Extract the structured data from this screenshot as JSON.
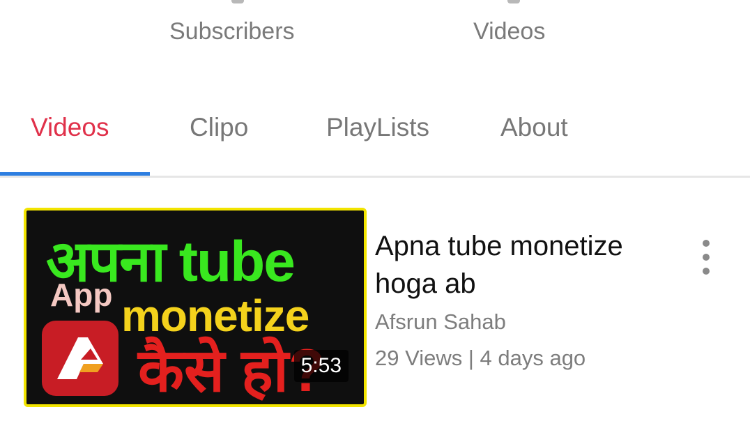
{
  "stats": {
    "subscribers_label": "Subscribers",
    "videos_label": "Videos"
  },
  "tabs": [
    {
      "label": "Videos",
      "active": true
    },
    {
      "label": "Clipo",
      "active": false
    },
    {
      "label": "PlayLists",
      "active": false
    },
    {
      "label": "About",
      "active": false
    }
  ],
  "video": {
    "title": "Apna tube monetize hoga ab",
    "channel": "Afsrun Sahab",
    "meta": "29 Views | 4 days ago",
    "duration": "5:53",
    "thumbnail": {
      "line1": "अपना tube",
      "app": "App",
      "monetize": "monetize",
      "line3": "कैसे हो?"
    }
  },
  "colors": {
    "active_tab": "#e0314a",
    "tab_underline": "#2d7ee0",
    "inactive_text": "#777777"
  },
  "icons": [
    "more-vert-icon",
    "app-logo-icon"
  ]
}
